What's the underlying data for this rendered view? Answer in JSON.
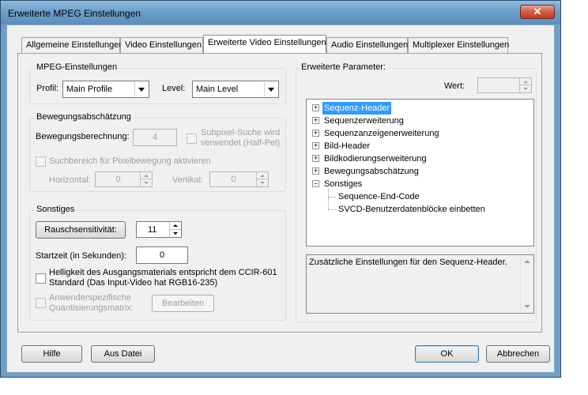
{
  "window": {
    "title": "Erweiterte MPEG Einstellungen",
    "close_glyph": "✕"
  },
  "tabs": [
    {
      "label": "Allgemeine Einstellungen"
    },
    {
      "label": "Video Einstellungen"
    },
    {
      "label": "Erweiterte Video Einstellungen"
    },
    {
      "label": "Audio Einstellungen"
    },
    {
      "label": "Multiplexer Einstellungen"
    }
  ],
  "mpeg": {
    "group_label": "MPEG-Einstellungen",
    "profile_label": "Profil:",
    "profile_value": "Main Profile",
    "level_label": "Level:",
    "level_value": "Main Level"
  },
  "motion": {
    "group_label": "Bewegungsabschätzung",
    "calc_label": "Bewegungsberechnung:",
    "calc_value": "4",
    "subpixel_line1": "Subpixel-Suche wird",
    "subpixel_line2": "verwendet (Half-Pel)",
    "range_label": "Suchbereich für Pixelbewegung aktivieren",
    "horizontal_label": "Horizontal:",
    "horizontal_value": "0",
    "vertical_label": "Vertikal:",
    "vertical_value": "0"
  },
  "misc": {
    "group_label": "Sonstiges",
    "noise_button": "Rauschsensitivität:",
    "noise_value": "11",
    "start_label": "Startzeit (in Sekunden):",
    "start_value": "0",
    "brightness_line1": "Helligkeit des Ausgangsmaterials entspricht dem CCIR-601",
    "brightness_line2": "Standard (Das Input-Video hat RGB16-235)",
    "quant_line1": "Anwenderspezifische",
    "quant_line2": "Quantisierungsmatrix:",
    "edit_button": "Bearbeiten"
  },
  "advanced": {
    "group_label": "Erweiterte Parameter:",
    "value_label": "Wert:",
    "tree": [
      {
        "label": "Sequenz-Header",
        "expander": "+"
      },
      {
        "label": "Sequenzerweiterung",
        "expander": "+"
      },
      {
        "label": "Sequenzanzeigenerweiterung",
        "expander": "+"
      },
      {
        "label": "Bild-Header",
        "expander": "+"
      },
      {
        "label": "Bildkodierungserweiterung",
        "expander": "+"
      },
      {
        "label": "Bewegungsabschätzung",
        "expander": "+"
      },
      {
        "label": "Sonstiges",
        "expander": "−"
      },
      {
        "label": "Sequence-End-Code"
      },
      {
        "label": "SVCD-Benutzerdatenblöcke einbetten"
      }
    ],
    "description": "Zusätzliche Einstellungen für den Sequenz-Header."
  },
  "footer": {
    "help": "Hilfe",
    "from_file": "Aus Datei",
    "ok": "OK",
    "cancel": "Abbrechen"
  },
  "colors": {
    "titlebar": "#6f9fc9",
    "close_button": "#c23b22",
    "selection": "#3399ff",
    "dialog_bg": "#f0f0f0"
  }
}
